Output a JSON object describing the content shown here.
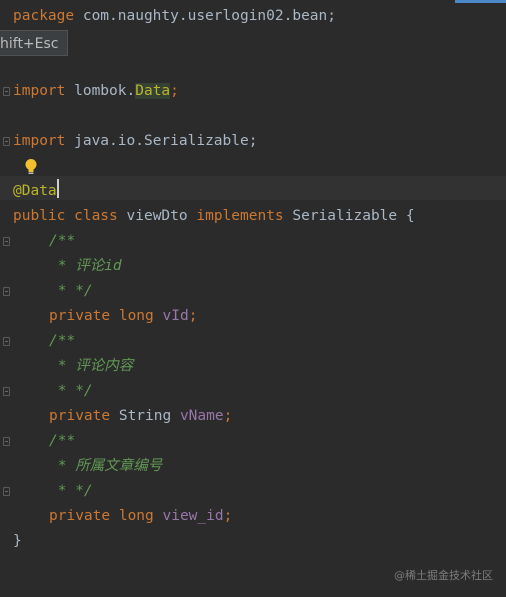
{
  "popup": {
    "shortcut": "hift+Esc"
  },
  "code": {
    "line1": {
      "kw": "package",
      "rest": " com.naughty.userlogin02.bean;"
    },
    "line3": {
      "kw": "import",
      "pre": " lombok.",
      "hl": "Data",
      "post": ";"
    },
    "line5": {
      "kw": "import",
      "rest": " java.io.Serializable;"
    },
    "line6": {
      "annotation": "@Data"
    },
    "line7": {
      "kw1": "public",
      "kw2": " class",
      "name": " viewDto",
      "kw3": " implements",
      "iface": " Serializable",
      "brace": " {"
    },
    "c1": {
      "open": "/**",
      "text": " * 评论id",
      "close": " * */"
    },
    "f1": {
      "kw1": "private",
      "kw2": " long",
      "name": " vId",
      "semi": ";"
    },
    "c2": {
      "open": "/**",
      "text": " * 评论内容",
      "close": " * */"
    },
    "f2": {
      "kw": "private",
      "type": " String",
      "name": " vName",
      "semi": ";"
    },
    "c3": {
      "open": "/**",
      "text": " * 所属文章编号",
      "close": " * */"
    },
    "f3": {
      "kw1": "private",
      "kw2": " long",
      "name": " view_id",
      "semi": ";"
    },
    "end": "}"
  },
  "watermark": "@稀土掘金技术社区",
  "colors": {
    "background": "#2b2b2b",
    "keyword": "#cc7832",
    "annotation": "#bbb529",
    "comment": "#629755",
    "field": "#9876aa",
    "text": "#a9b7c6"
  },
  "icons": {
    "intention": "lightbulb-icon",
    "fold": "fold-marker-icon"
  }
}
